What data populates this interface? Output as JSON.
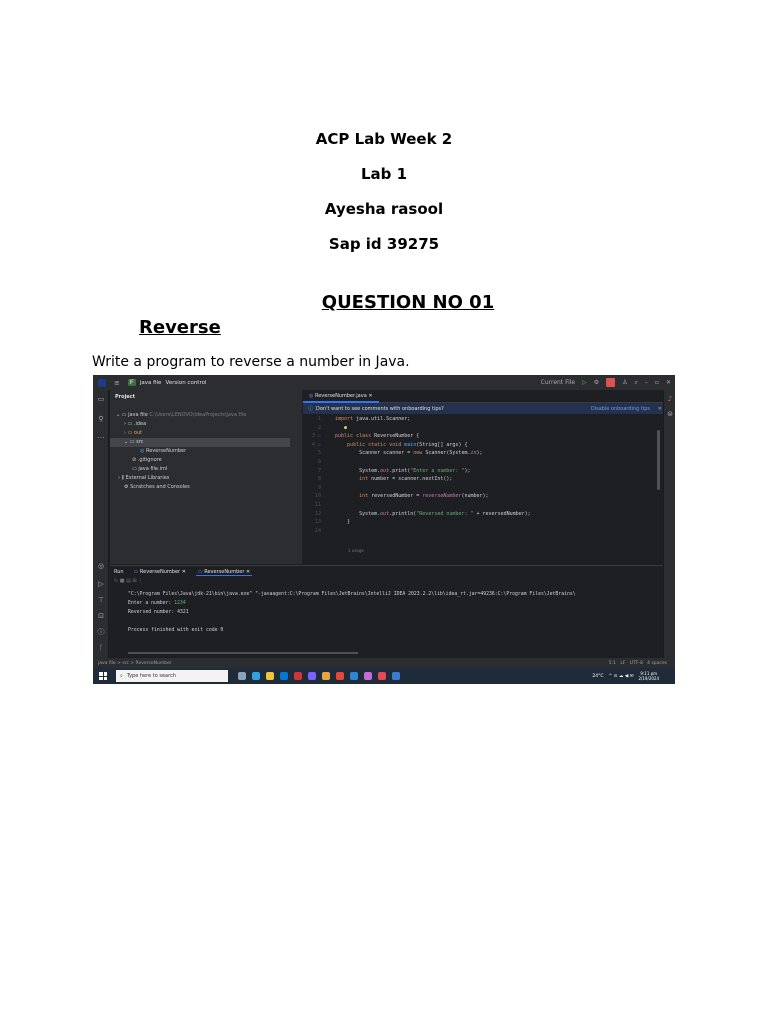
{
  "document": {
    "title": "ACP Lab Week 2",
    "lab": "Lab 1",
    "author": "Ayesha rasool",
    "sap": "Sap id 39275",
    "question": "QUESTION NO 01",
    "subheading": "Reverse",
    "task": "Write a program to reverse a number in Java."
  },
  "ide": {
    "titlebar": {
      "project": "JF",
      "project_name": "java file",
      "vcs": "Version control",
      "run_config": "Current File"
    },
    "project_panel": {
      "header": "Project",
      "root": "java file",
      "root_path": "C:\\Users\\LENOVO\\IdeaProjects\\java file",
      "items": [
        ".idea",
        "out",
        "src",
        "ReverseNumber",
        ".gitignore",
        "java file.iml",
        "External Libraries",
        "Scratches and Consoles"
      ]
    },
    "editor": {
      "tab": "ReverseNumber.java",
      "banner": "Don't want to see comments with onboarding tips?",
      "banner_link": "Disable onboarding tips",
      "usage": "1 usage"
    },
    "run": {
      "label": "Run",
      "tab1": "ReverseNumber",
      "tab2": "ReverseNumber",
      "command": "\"C:\\Program Files\\Java\\jdk-21\\bin\\java.exe\" \"-javaagent:C:\\Program Files\\JetBrains\\IntelliJ IDEA 2023.2.2\\lib\\idea_rt.jar=49236:C:\\Program Files\\JetBrains\\",
      "prompt": "Enter a number: ",
      "input": "1234",
      "output": "Reversed number: 4321",
      "exit": "Process finished with exit code 0"
    },
    "status": {
      "breadcrumb": "java file  >  src  >  ReverseNumber",
      "position": "5:1",
      "line_sep": "LF",
      "encoding": "UTF-8",
      "indent": "4 spaces"
    },
    "taskbar": {
      "search_placeholder": "Type here to search",
      "temperature": "24°C",
      "time": "9:11 pm",
      "date": "2/19/2024"
    }
  },
  "colors": {
    "ide_bg": "#1e1f22",
    "panel_bg": "#2b2d30",
    "keyword": "#cf8e6d",
    "string": "#6aab73",
    "accent": "#3574f0"
  }
}
